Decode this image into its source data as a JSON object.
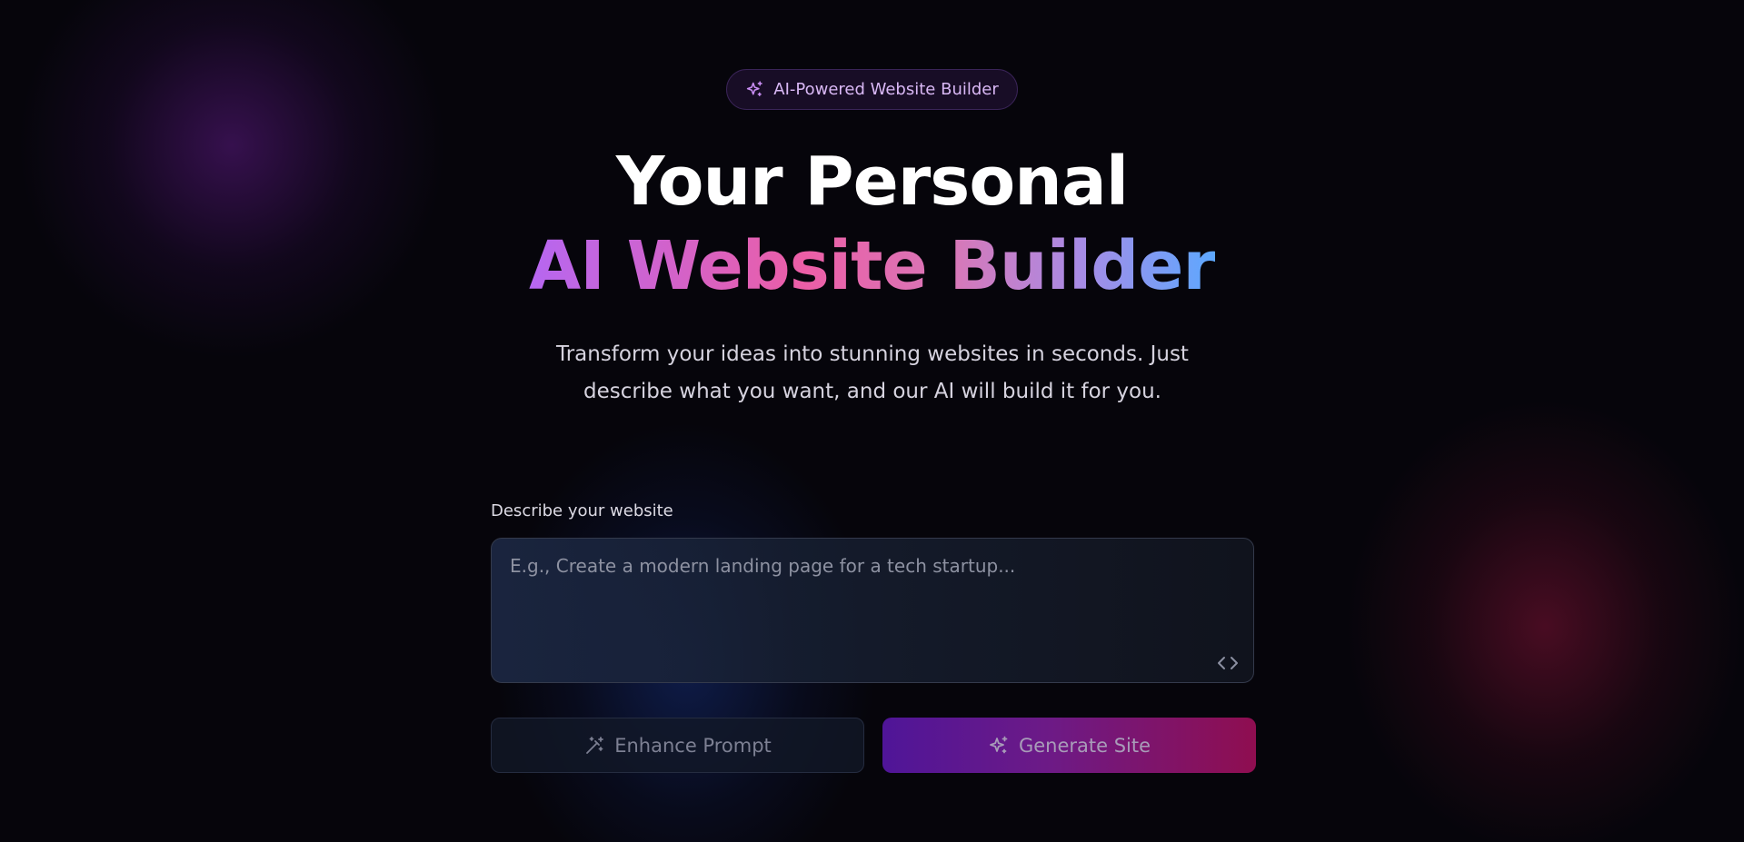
{
  "badge": {
    "label": "AI-Powered Website Builder",
    "icon": "sparkles-icon"
  },
  "hero": {
    "title_line1": "Your Personal",
    "title_line2": "AI Website Builder",
    "subtitle": "Transform your ideas into stunning websites in seconds. Just describe what you want, and our AI will build it for you."
  },
  "prompt": {
    "label": "Describe your website",
    "value": "",
    "placeholder": "E.g., Create a modern landing page for a tech startup...",
    "corner_icon": "code-icon"
  },
  "actions": {
    "enhance_label": "Enhance Prompt",
    "enhance_icon": "magic-wand-icon",
    "generate_label": "Generate Site",
    "generate_icon": "sparkles-icon"
  },
  "colors": {
    "background": "#06050b",
    "badge_text": "#d9b8f5",
    "title": "#ffffff",
    "gradient_start": "#b667f1",
    "gradient_mid": "#ec5ea6",
    "gradient_end": "#5da8ff",
    "generate_start": "#4f1598",
    "generate_end": "#8f0e50"
  }
}
